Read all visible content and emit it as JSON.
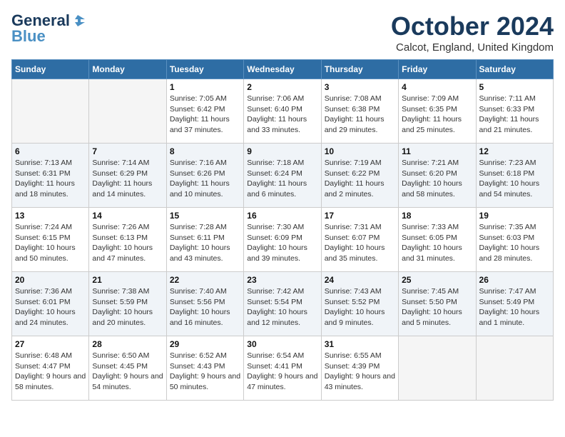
{
  "header": {
    "logo_general": "General",
    "logo_blue": "Blue",
    "month_title": "October 2024",
    "location": "Calcot, England, United Kingdom"
  },
  "weekdays": [
    "Sunday",
    "Monday",
    "Tuesday",
    "Wednesday",
    "Thursday",
    "Friday",
    "Saturday"
  ],
  "weeks": [
    [
      {
        "day": "",
        "info": ""
      },
      {
        "day": "",
        "info": ""
      },
      {
        "day": "1",
        "info": "Sunrise: 7:05 AM\nSunset: 6:42 PM\nDaylight: 11 hours and 37 minutes."
      },
      {
        "day": "2",
        "info": "Sunrise: 7:06 AM\nSunset: 6:40 PM\nDaylight: 11 hours and 33 minutes."
      },
      {
        "day": "3",
        "info": "Sunrise: 7:08 AM\nSunset: 6:38 PM\nDaylight: 11 hours and 29 minutes."
      },
      {
        "day": "4",
        "info": "Sunrise: 7:09 AM\nSunset: 6:35 PM\nDaylight: 11 hours and 25 minutes."
      },
      {
        "day": "5",
        "info": "Sunrise: 7:11 AM\nSunset: 6:33 PM\nDaylight: 11 hours and 21 minutes."
      }
    ],
    [
      {
        "day": "6",
        "info": "Sunrise: 7:13 AM\nSunset: 6:31 PM\nDaylight: 11 hours and 18 minutes."
      },
      {
        "day": "7",
        "info": "Sunrise: 7:14 AM\nSunset: 6:29 PM\nDaylight: 11 hours and 14 minutes."
      },
      {
        "day": "8",
        "info": "Sunrise: 7:16 AM\nSunset: 6:26 PM\nDaylight: 11 hours and 10 minutes."
      },
      {
        "day": "9",
        "info": "Sunrise: 7:18 AM\nSunset: 6:24 PM\nDaylight: 11 hours and 6 minutes."
      },
      {
        "day": "10",
        "info": "Sunrise: 7:19 AM\nSunset: 6:22 PM\nDaylight: 11 hours and 2 minutes."
      },
      {
        "day": "11",
        "info": "Sunrise: 7:21 AM\nSunset: 6:20 PM\nDaylight: 10 hours and 58 minutes."
      },
      {
        "day": "12",
        "info": "Sunrise: 7:23 AM\nSunset: 6:18 PM\nDaylight: 10 hours and 54 minutes."
      }
    ],
    [
      {
        "day": "13",
        "info": "Sunrise: 7:24 AM\nSunset: 6:15 PM\nDaylight: 10 hours and 50 minutes."
      },
      {
        "day": "14",
        "info": "Sunrise: 7:26 AM\nSunset: 6:13 PM\nDaylight: 10 hours and 47 minutes."
      },
      {
        "day": "15",
        "info": "Sunrise: 7:28 AM\nSunset: 6:11 PM\nDaylight: 10 hours and 43 minutes."
      },
      {
        "day": "16",
        "info": "Sunrise: 7:30 AM\nSunset: 6:09 PM\nDaylight: 10 hours and 39 minutes."
      },
      {
        "day": "17",
        "info": "Sunrise: 7:31 AM\nSunset: 6:07 PM\nDaylight: 10 hours and 35 minutes."
      },
      {
        "day": "18",
        "info": "Sunrise: 7:33 AM\nSunset: 6:05 PM\nDaylight: 10 hours and 31 minutes."
      },
      {
        "day": "19",
        "info": "Sunrise: 7:35 AM\nSunset: 6:03 PM\nDaylight: 10 hours and 28 minutes."
      }
    ],
    [
      {
        "day": "20",
        "info": "Sunrise: 7:36 AM\nSunset: 6:01 PM\nDaylight: 10 hours and 24 minutes."
      },
      {
        "day": "21",
        "info": "Sunrise: 7:38 AM\nSunset: 5:59 PM\nDaylight: 10 hours and 20 minutes."
      },
      {
        "day": "22",
        "info": "Sunrise: 7:40 AM\nSunset: 5:56 PM\nDaylight: 10 hours and 16 minutes."
      },
      {
        "day": "23",
        "info": "Sunrise: 7:42 AM\nSunset: 5:54 PM\nDaylight: 10 hours and 12 minutes."
      },
      {
        "day": "24",
        "info": "Sunrise: 7:43 AM\nSunset: 5:52 PM\nDaylight: 10 hours and 9 minutes."
      },
      {
        "day": "25",
        "info": "Sunrise: 7:45 AM\nSunset: 5:50 PM\nDaylight: 10 hours and 5 minutes."
      },
      {
        "day": "26",
        "info": "Sunrise: 7:47 AM\nSunset: 5:49 PM\nDaylight: 10 hours and 1 minute."
      }
    ],
    [
      {
        "day": "27",
        "info": "Sunrise: 6:48 AM\nSunset: 4:47 PM\nDaylight: 9 hours and 58 minutes."
      },
      {
        "day": "28",
        "info": "Sunrise: 6:50 AM\nSunset: 4:45 PM\nDaylight: 9 hours and 54 minutes."
      },
      {
        "day": "29",
        "info": "Sunrise: 6:52 AM\nSunset: 4:43 PM\nDaylight: 9 hours and 50 minutes."
      },
      {
        "day": "30",
        "info": "Sunrise: 6:54 AM\nSunset: 4:41 PM\nDaylight: 9 hours and 47 minutes."
      },
      {
        "day": "31",
        "info": "Sunrise: 6:55 AM\nSunset: 4:39 PM\nDaylight: 9 hours and 43 minutes."
      },
      {
        "day": "",
        "info": ""
      },
      {
        "day": "",
        "info": ""
      }
    ]
  ]
}
